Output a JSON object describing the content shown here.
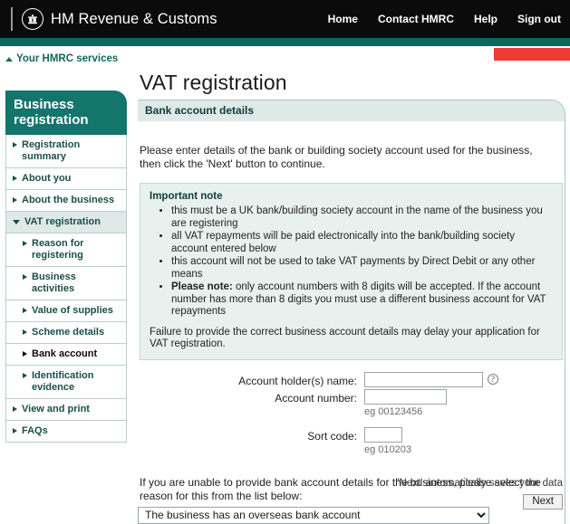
{
  "header": {
    "brand": "HM Revenue & Customs",
    "logo_icon": "hmrc-crown-crest-icon",
    "nav": [
      {
        "label": "Home"
      },
      {
        "label": "Contact HMRC"
      },
      {
        "label": "Help"
      },
      {
        "label": "Sign out"
      }
    ],
    "colors": {
      "bar": "#0b0b0b",
      "teal": "#11655f",
      "flash": "#ef3b33"
    }
  },
  "services_link": {
    "label": "Your HMRC services",
    "icon": "triangle-up-icon"
  },
  "sidebar": {
    "title": "Business registration",
    "items": [
      {
        "label": "Registration summary",
        "icon": "triangle-right-icon",
        "level": 1,
        "state": "closed"
      },
      {
        "label": "About you",
        "icon": "triangle-right-icon",
        "level": 1,
        "state": "closed"
      },
      {
        "label": "About the business",
        "icon": "triangle-right-icon",
        "level": 1,
        "state": "closed"
      },
      {
        "label": "VAT registration",
        "icon": "triangle-down-icon",
        "level": 1,
        "state": "open"
      },
      {
        "label": "Reason for registering",
        "icon": "triangle-right-icon",
        "level": 2,
        "state": "closed"
      },
      {
        "label": "Business activities",
        "icon": "triangle-right-icon",
        "level": 2,
        "state": "closed"
      },
      {
        "label": "Value of supplies",
        "icon": "triangle-right-icon",
        "level": 2,
        "state": "closed"
      },
      {
        "label": "Scheme details",
        "icon": "triangle-right-icon",
        "level": 2,
        "state": "closed"
      },
      {
        "label": "Bank account",
        "icon": "triangle-right-icon",
        "level": 2,
        "state": "current"
      },
      {
        "label": "Identification evidence",
        "icon": "triangle-right-icon",
        "level": 2,
        "state": "closed"
      },
      {
        "label": "View and print",
        "icon": "triangle-right-icon",
        "level": 1,
        "state": "closed"
      },
      {
        "label": "FAQs",
        "icon": "triangle-right-icon",
        "level": 1,
        "state": "closed"
      }
    ]
  },
  "main": {
    "page_title": "VAT registration",
    "panel_heading": "Bank account details",
    "intro": "Please enter details of the bank or building society account used for the business, then click the 'Next' button to continue.",
    "note": {
      "heading": "Important note",
      "bullets": [
        "this must be a UK bank/building society account in the name of the business you are registering",
        "all VAT repayments will be paid electronically into the bank/building society account entered below",
        "this account will not be used to take VAT payments by Direct Debit or any other means"
      ],
      "bullet_bold_prefix": "Please note:",
      "bullet_bold_rest": " only account numbers with 8 digits will be accepted. If the account number has more than 8 digits you must use a different business account for VAT repayments",
      "tail": "Failure to provide the correct business account details may delay your application for VAT registration."
    },
    "fields": {
      "account_holder": {
        "label": "Account holder(s) name:",
        "value": "",
        "placeholder": "",
        "help_icon": "question-mark-icon"
      },
      "account_number": {
        "label": "Account number:",
        "value": "",
        "placeholder": "",
        "hint": "eg 00123456"
      },
      "sort_code": {
        "label": "Sort code:",
        "value": "",
        "placeholder": "",
        "hint": "eg 010203"
      }
    },
    "reason": {
      "prompt": "If you are unable to provide bank account details for the business, please select the reason for this from the list below:",
      "selected": "The business has an overseas bank account",
      "options": [
        "The business has an overseas bank account"
      ],
      "icon": "chevron-down-icon"
    },
    "footer": {
      "autosave_note": "'Next' automatically saves your data",
      "next_label": "Next"
    }
  }
}
